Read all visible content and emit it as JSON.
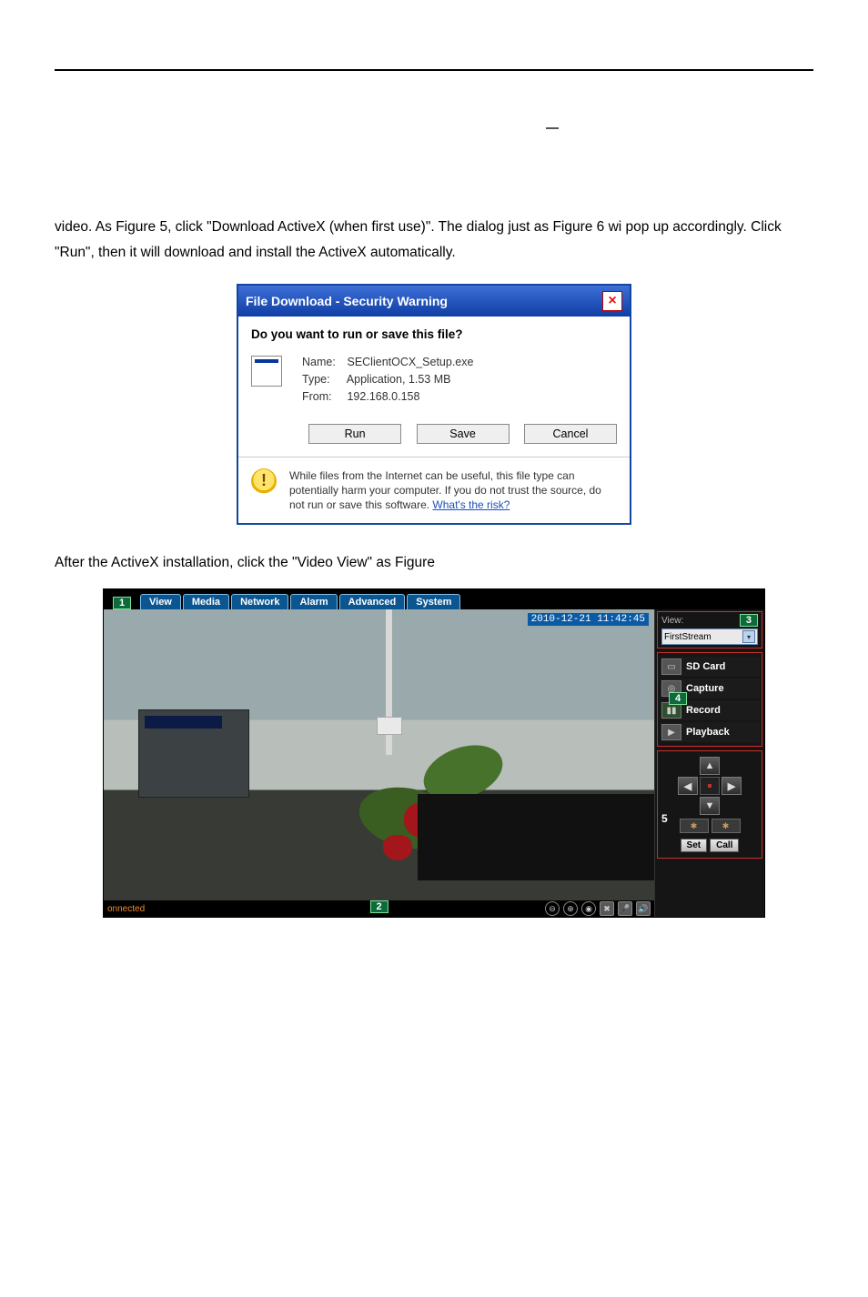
{
  "top_dash": "–",
  "paragraph1": "video. As Figure 5, click \"Download ActiveX (when first use)\". The dialog just as Figure 6 wi pop up accordingly. Click \"Run\", then it will download and install the ActiveX automatically.",
  "paragraph2": "After the ActiveX installation, click the \"Video View\" as Figure",
  "dialog": {
    "title": "File Download - Security Warning",
    "question": "Do you want to run or save this file?",
    "name_k": "Name:",
    "name_v": "SEClientOCX_Setup.exe",
    "type_k": "Type:",
    "type_v": "Application, 1.53 MB",
    "from_k": "From:",
    "from_v": "192.168.0.158",
    "btn_run": "Run",
    "btn_save": "Save",
    "btn_cancel": "Cancel",
    "warn_text": "While files from the Internet can be useful, this file type can potentially harm your computer. If you do not trust the source, do not run or save this software. ",
    "warn_link": "What's the risk?"
  },
  "cam": {
    "badge1": "1",
    "tabs": {
      "view": "View",
      "media": "Media",
      "network": "Network",
      "alarm": "Alarm",
      "advanced": "Advanced",
      "system": "System"
    },
    "timestamp": "2010-12-21 11:42:45",
    "status_left": "onnected",
    "badge2": "2",
    "side": {
      "badge3": "3",
      "view_label": "View:",
      "stream_sel": "FirstStream",
      "badge4": "4",
      "btn_sd": "SD Card",
      "btn_capture": "Capture",
      "btn_record": "Record",
      "btn_playback": "Playback",
      "badge5": "5",
      "btn_set": "Set",
      "btn_call": "Call"
    }
  }
}
